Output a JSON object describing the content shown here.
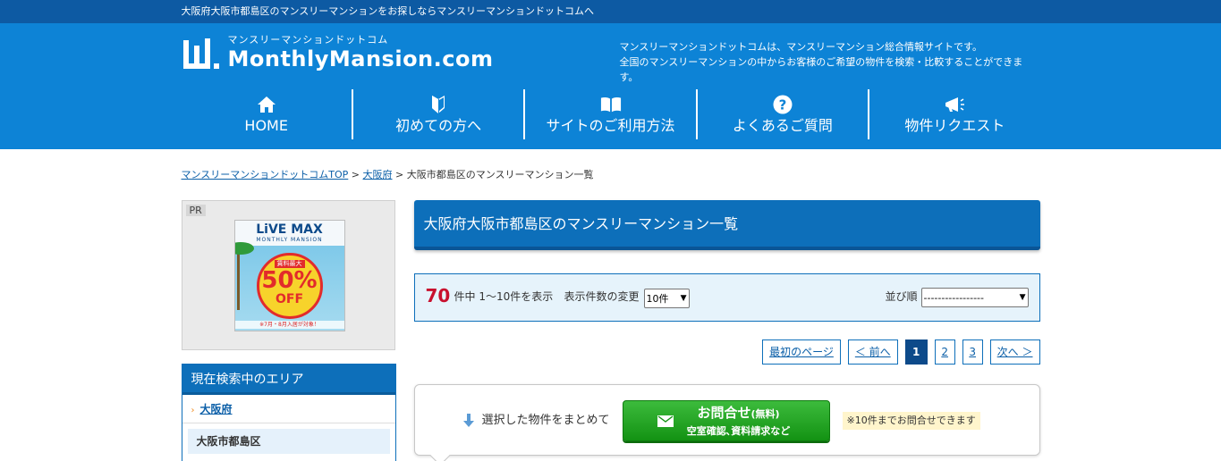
{
  "topbar": {
    "text": "大阪府大阪市都島区のマンスリーマンションをお探しならマンスリーマンションドットコムへ"
  },
  "header": {
    "logo_sub": "マンスリーマンションドットコム",
    "logo_main": "MonthlyMansion.com",
    "tagline_1": "マンスリーマンションドットコムは、マンスリーマンション総合情報サイトです。",
    "tagline_2": "全国のマンスリーマンションの中からお客様のご希望の物件を検索・比較することができます。"
  },
  "nav": {
    "home": "HOME",
    "beginners": "初めての方へ",
    "howto": "サイトのご利用方法",
    "faq": "よくあるご質問",
    "request": "物件リクエスト"
  },
  "breadcrumb": {
    "top": "マンスリーマンションドットコムTOP",
    "sep1": " > ",
    "osaka": "大阪府",
    "sep2": " > ",
    "current": "大阪市都島区のマンスリーマンション一覧"
  },
  "sidebar": {
    "pr_label": "PR",
    "banner": {
      "brand": "LiVE MAX",
      "brand_sub": "MONTHLY MANSION",
      "badge_small": "賃料最大",
      "badge_big": "50%",
      "badge_off": "OFF",
      "foot": "※7月・8月入居が対象！"
    },
    "area_heading": "現在検索中のエリア",
    "area_pref": "大阪府",
    "area_city": "大阪市都島区"
  },
  "main": {
    "title": "大阪府大阪市都島区のマンスリーマンション一覧",
    "count": "70",
    "count_text": "件中 1～10件を表示",
    "per_page_label": "表示件数の変更",
    "per_page_value": "10件",
    "sort_label": "並び順",
    "sort_value": "-----------------"
  },
  "pager": {
    "first": "最初のページ",
    "prev": "＜ 前へ",
    "pages": [
      "1",
      "2",
      "3"
    ],
    "next": "次へ ＞"
  },
  "inquiry": {
    "lead": "選択した物件をまとめて",
    "button_main": "お問合せ",
    "button_free": "(無料)",
    "button_sub": "空室確認､資料請求など",
    "note": "※10件までお問合せできます"
  },
  "colors": {
    "topbar": "#0d5aa3",
    "header": "#0d83d6",
    "accent": "#0d6fba",
    "count": "#c8102e",
    "cta": "#139213"
  }
}
